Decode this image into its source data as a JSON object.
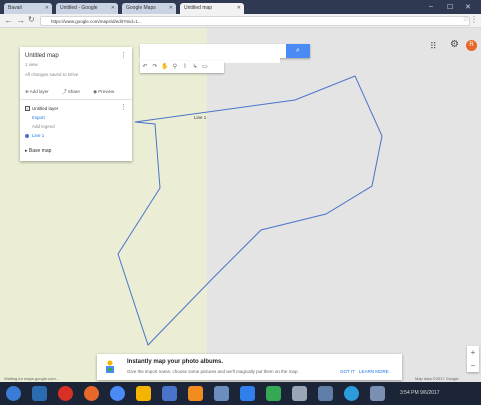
{
  "browser": {
    "tabs": [
      {
        "label": "Bavait",
        "active": false
      },
      {
        "label": "Untitled - Google",
        "active": false
      },
      {
        "label": "Google Maps",
        "active": false
      },
      {
        "label": "Untitled map",
        "active": true
      }
    ],
    "url": "https://www.google.com/maps/d/edit?mid=1..."
  },
  "map_panel": {
    "title": "Untitled map",
    "subtitle": "1 view",
    "saved_status": "All changes saved to Drive",
    "actions": [
      "Add layer",
      "Share",
      "Preview"
    ],
    "layer": {
      "title": "Untitled layer",
      "links": [
        "Import",
        "Add legend"
      ],
      "item": "Line 1"
    },
    "base_map": "Base map"
  },
  "search": {
    "placeholder": "",
    "button_icon": "search-icon"
  },
  "tools": [
    "undo-icon",
    "redo-icon",
    "hand-icon",
    "marker-icon",
    "draw-line-icon",
    "route-icon",
    "ruler-icon"
  ],
  "line_label": "Line 1",
  "user": {
    "avatar_letter": "R"
  },
  "promo": {
    "title": "Instantly map your photo albums.",
    "body": "Give the import name, choose some pictures and we'll magically put them on the map.",
    "link_primary": "GOT IT",
    "link_secondary": "LEARN MORE"
  },
  "status_text": "Waiting for maps.google.com...",
  "copyright": "Map data ©2017 Google",
  "taskbar": {
    "clock": "3:54 PM  9/6/2017"
  },
  "colors": {
    "polygon": "#4a74c9",
    "search_button": "#4a8af4",
    "avatar": "#e8682c"
  }
}
